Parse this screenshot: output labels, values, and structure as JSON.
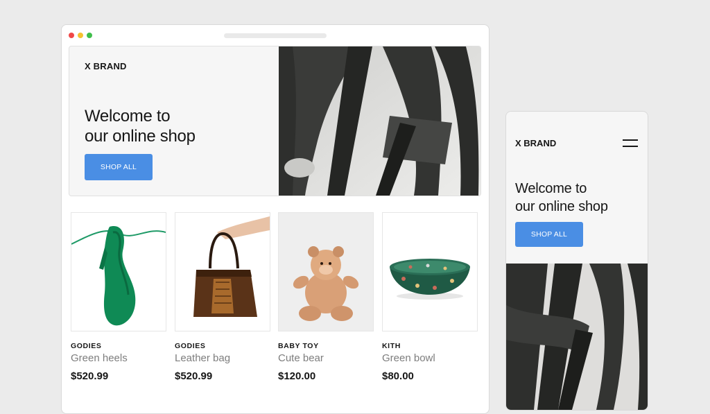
{
  "desktop": {
    "brand": "X BRAND",
    "headline_line1": "Welcome to",
    "headline_line2": "our online shop",
    "cta": "SHOP ALL",
    "accent_color": "#4a8ee4",
    "products": [
      {
        "brand": "GODIES",
        "name": "Green heels",
        "price": "$520.99",
        "image": "green-heel-shoe"
      },
      {
        "brand": "GODIES",
        "name": "Leather bag",
        "price": "$520.99",
        "image": "leather-handbag"
      },
      {
        "brand": "BABY TOY",
        "name": "Cute bear",
        "price": "$120.00",
        "image": "teddy-bear"
      },
      {
        "brand": "KITH",
        "name": "Green bowl",
        "price": "$80.00",
        "image": "ceramic-bowl"
      }
    ]
  },
  "mobile": {
    "brand": "X BRAND",
    "headline_line1": "Welcome to",
    "headline_line2": "our online shop",
    "cta": "SHOP ALL",
    "menu_icon": "hamburger-menu-icon"
  }
}
